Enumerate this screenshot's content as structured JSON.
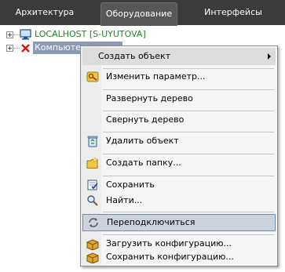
{
  "tabs": [
    {
      "label": "Архитектура"
    },
    {
      "label": "Оборудование"
    },
    {
      "label": "Интерфейсы"
    }
  ],
  "tree": {
    "nodes": [
      {
        "label": "LOCALHOST [S-UYUTOVA]",
        "icon": "monitor-icon"
      },
      {
        "label": "Компьютер",
        "icon": "red-x-icon"
      }
    ]
  },
  "context_menu": {
    "items": [
      {
        "label": "Создать объект",
        "icon": "",
        "submenu": true
      },
      {
        "label": "Изменить параметр...",
        "icon": "key-icon"
      },
      {
        "label": "Развернуть дерево",
        "icon": ""
      },
      {
        "label": "Свернуть дерево",
        "icon": ""
      },
      {
        "label": "Удалить объект",
        "icon": "recycle-bin-icon"
      },
      {
        "label": "Создать папку...",
        "icon": "new-folder-icon"
      },
      {
        "label": "Сохранить",
        "icon": "save-check-icon"
      },
      {
        "label": "Найти...",
        "icon": "magnifier-icon"
      },
      {
        "label": "Переподключиться",
        "icon": "reconnect-icon"
      },
      {
        "label": "Загрузить конфигурацию...",
        "icon": "box-load-icon"
      },
      {
        "label": "Сохранить конфигурацию...",
        "icon": "box-save-icon"
      }
    ]
  }
}
